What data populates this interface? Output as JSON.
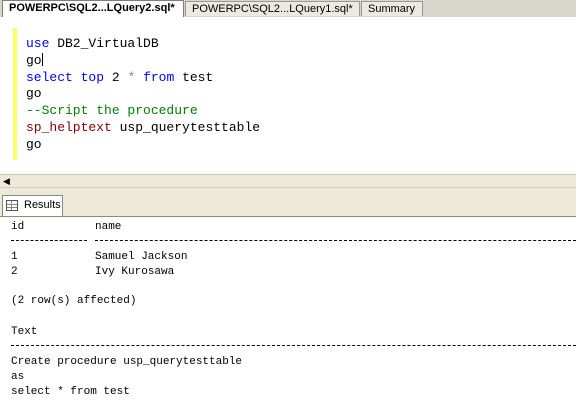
{
  "tabs": [
    {
      "label": "POWERPC\\SQL2...LQuery2.sql*",
      "active": true
    },
    {
      "label": "POWERPC\\SQL2...LQuery1.sql*",
      "active": false
    },
    {
      "label": "Summary",
      "active": false
    }
  ],
  "editor": {
    "lines": [
      {
        "parts": [
          {
            "t": "use",
            "c": "kw"
          },
          {
            "t": " DB2_VirtualDB",
            "c": ""
          }
        ]
      },
      {
        "parts": [
          {
            "t": "go",
            "c": ""
          }
        ],
        "caret": true
      },
      {
        "parts": [
          {
            "t": "select",
            "c": "kw"
          },
          {
            "t": " ",
            "c": ""
          },
          {
            "t": "top",
            "c": "kw"
          },
          {
            "t": " 2 ",
            "c": ""
          },
          {
            "t": "*",
            "c": "op"
          },
          {
            "t": " ",
            "c": ""
          },
          {
            "t": "from",
            "c": "kw"
          },
          {
            "t": " test",
            "c": ""
          }
        ]
      },
      {
        "parts": [
          {
            "t": "go",
            "c": ""
          }
        ]
      },
      {
        "parts": [
          {
            "t": "--Script the procedure",
            "c": "cmt"
          }
        ]
      },
      {
        "parts": [
          {
            "t": "sp_helptext",
            "c": "sp"
          },
          {
            "t": " usp_querytesttable",
            "c": ""
          }
        ]
      },
      {
        "parts": [
          {
            "t": "go",
            "c": ""
          }
        ]
      }
    ]
  },
  "results_tab": {
    "label": "Results"
  },
  "results": {
    "col_id_header": "id",
    "col_name_header": "name",
    "rows": [
      {
        "id": "1",
        "name": "Samuel Jackson"
      },
      {
        "id": "2",
        "name": "Ivy Kurosawa"
      }
    ],
    "affected_message": "(2 row(s) affected)",
    "text_header": "Text",
    "text_lines": [
      "Create procedure usp_querytesttable",
      "as",
      "select * from test"
    ]
  }
}
